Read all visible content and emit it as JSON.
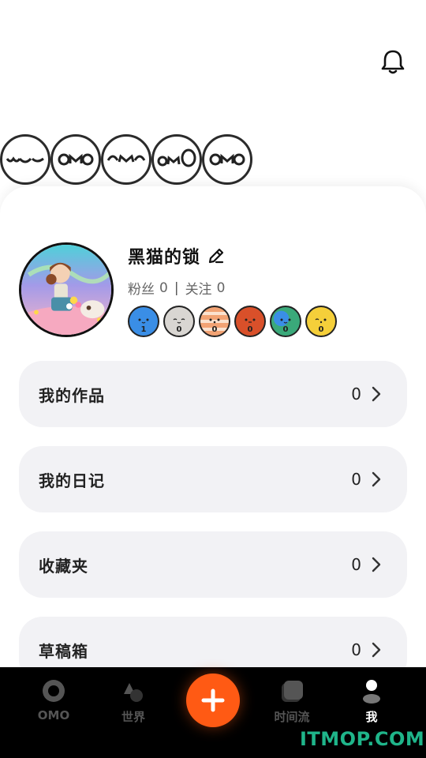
{
  "header": {
    "bell_icon": "bell-icon"
  },
  "omo_badges": [
    "omo-face-1",
    "omo-face-2",
    "omo-face-3",
    "omo-face-4",
    "omo-face-5"
  ],
  "profile": {
    "username": "黑猫的锁",
    "followers_label": "粉丝",
    "followers": "0",
    "separator": "|",
    "following_label": "关注",
    "following": "0",
    "planets": [
      {
        "color": "#3a8ee6",
        "count": "1"
      },
      {
        "color": "#d9d6d2",
        "count": "0"
      },
      {
        "color": "#f2a374",
        "count": "0"
      },
      {
        "color": "#d9502a",
        "count": "0"
      },
      {
        "color": "#3aa97a",
        "count": "0"
      },
      {
        "color": "#f5cf3a",
        "count": "0"
      }
    ]
  },
  "menu": [
    {
      "label": "我的作品",
      "count": "0"
    },
    {
      "label": "我的日记",
      "count": "0"
    },
    {
      "label": "收藏夹",
      "count": "0"
    },
    {
      "label": "草稿箱",
      "count": "0"
    }
  ],
  "tabbar": {
    "tabs": [
      {
        "label": "OMO",
        "icon": "omo-ring-icon"
      },
      {
        "label": "世界",
        "icon": "world-shapes-icon"
      },
      {
        "label": "时间流",
        "icon": "timeline-icon"
      },
      {
        "label": "我",
        "icon": "person-icon"
      }
    ],
    "create_icon": "plus-icon",
    "accent": "#ff5a14"
  },
  "watermark": "ITMOP.COM"
}
